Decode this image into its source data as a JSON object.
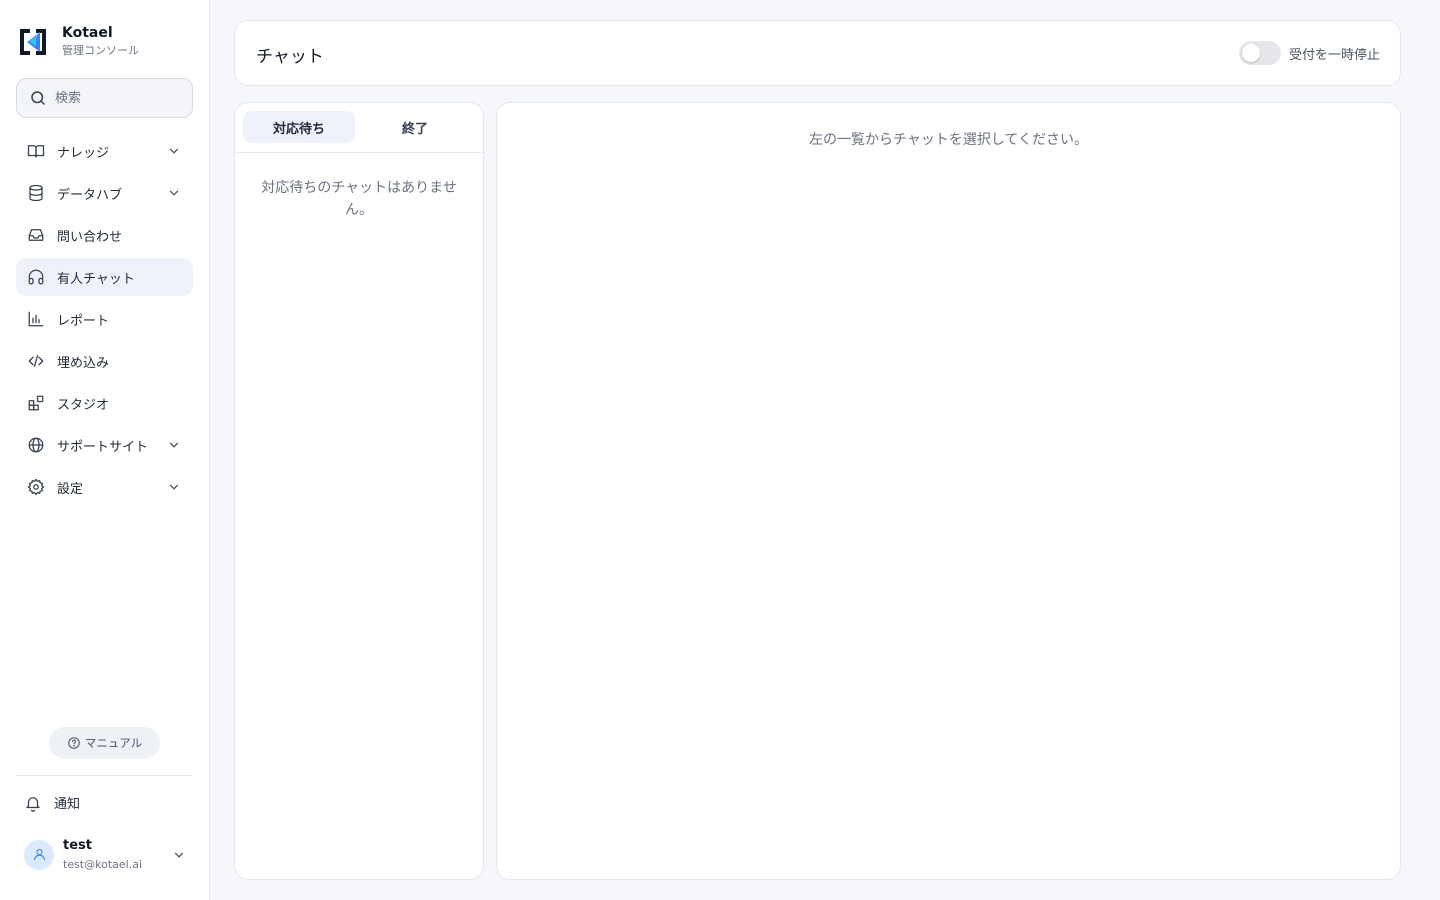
{
  "brand": {
    "name": "Kotael",
    "subtitle": "管理コンソール"
  },
  "search": {
    "placeholder": "検索"
  },
  "sidebar": {
    "items": [
      {
        "label": "ナレッジ",
        "icon": "book-icon",
        "expandable": true
      },
      {
        "label": "データハブ",
        "icon": "database-icon",
        "expandable": true
      },
      {
        "label": "問い合わせ",
        "icon": "inbox-icon",
        "expandable": false
      },
      {
        "label": "有人チャット",
        "icon": "headset-icon",
        "expandable": false,
        "active": true
      },
      {
        "label": "レポート",
        "icon": "bar-chart-icon",
        "expandable": false
      },
      {
        "label": "埋め込み",
        "icon": "code-icon",
        "expandable": false
      },
      {
        "label": "スタジオ",
        "icon": "blocks-icon",
        "expandable": false
      },
      {
        "label": "サポートサイト",
        "icon": "globe-icon",
        "expandable": true
      },
      {
        "label": "設定",
        "icon": "gear-icon",
        "expandable": true
      }
    ],
    "manual_label": "マニュアル",
    "notifications_label": "通知"
  },
  "user": {
    "name": "test",
    "email": "test@kotael.ai"
  },
  "header": {
    "title": "チャット",
    "toggle_label": "受付を一時停止",
    "toggle_on": false
  },
  "chat_list": {
    "tabs": [
      {
        "label": "対応待ち",
        "active": true
      },
      {
        "label": "終了",
        "active": false
      }
    ],
    "empty_message": "対応待ちのチャットはありません。"
  },
  "detail": {
    "placeholder": "左の一覧からチャットを選択してください。"
  },
  "colors": {
    "accent": "#2563eb",
    "active_bg": "#eef3fb",
    "background": "#f5f7fb"
  }
}
